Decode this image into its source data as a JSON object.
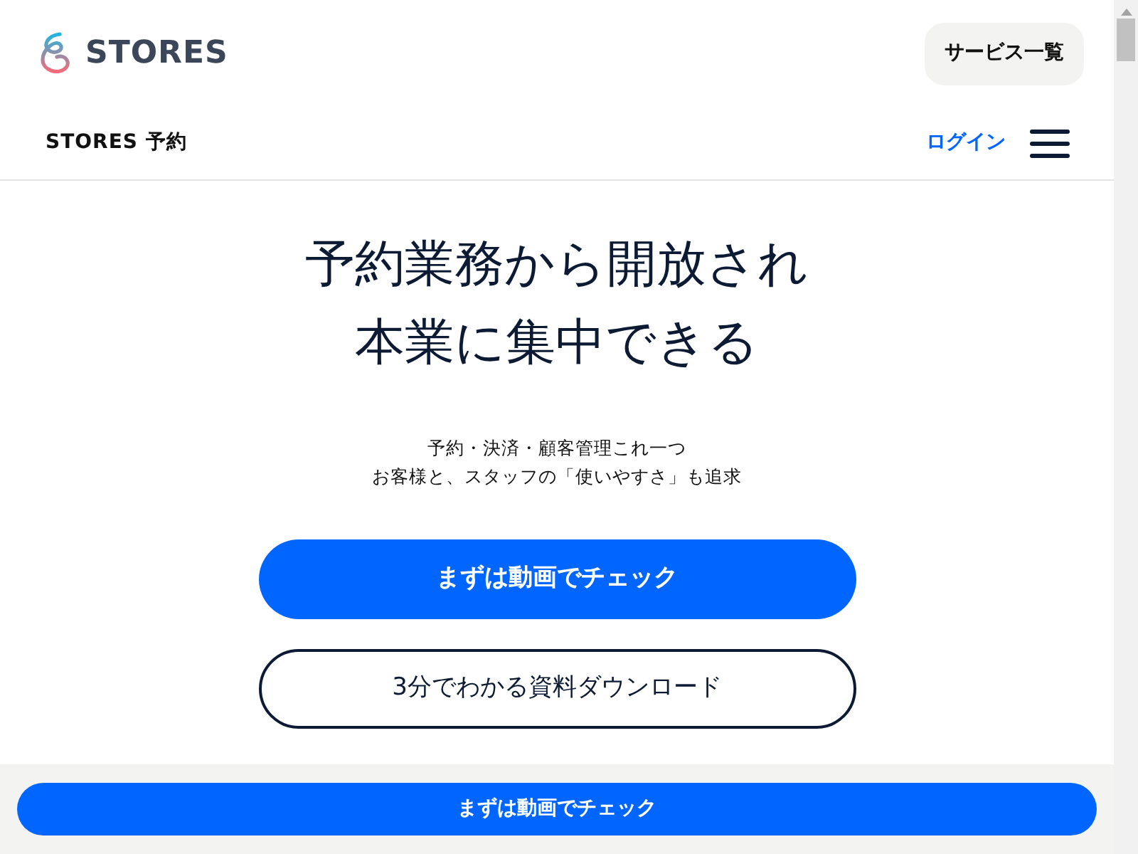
{
  "header": {
    "logo_text": "STORES",
    "services_button": "サービス一覧"
  },
  "nav": {
    "product_name": "STORES 予約",
    "login_link": "ログイン"
  },
  "hero": {
    "heading_lines": [
      "予約業務から開放され",
      "本業に集中できる"
    ],
    "subtext_lines": [
      "予約・決済・顧客管理これ一つ",
      "お客様と、スタッフの「使いやすさ」も追求"
    ],
    "buttons": [
      {
        "label": "まずは動画でチェック",
        "kind": "primary"
      },
      {
        "label": "3分でわかる資料ダウンロード",
        "kind": "outline"
      }
    ]
  },
  "sticky_bar": {
    "button": "まずは動画でチェック"
  }
}
